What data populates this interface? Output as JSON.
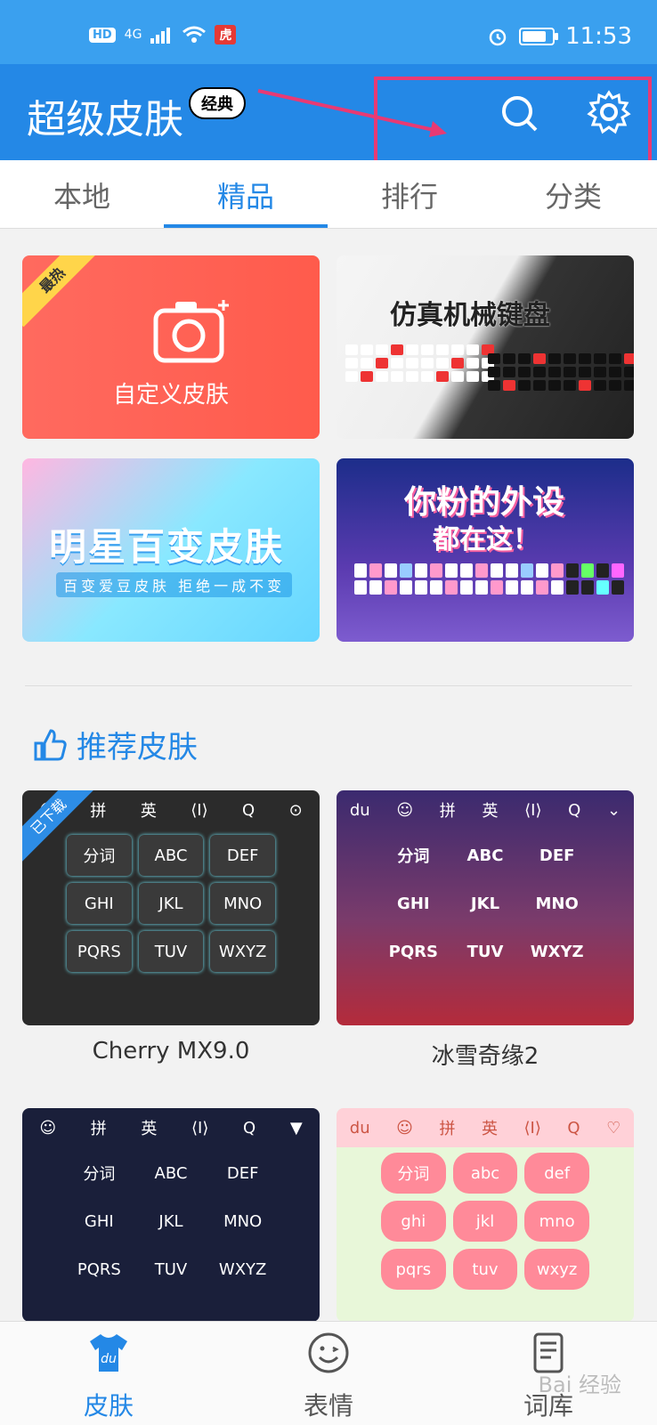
{
  "status_bar": {
    "hd": "HD",
    "network": "4G",
    "app_badge": "虎",
    "time": "11:53",
    "battery_level": 0.85
  },
  "app_bar": {
    "title": "超级皮肤",
    "badge": "经典"
  },
  "tabs": [
    "本地",
    "精品",
    "排行",
    "分类"
  ],
  "active_tab": 1,
  "banners": {
    "custom": {
      "label": "自定义皮肤",
      "ribbon": "最热"
    },
    "mechanical": {
      "title": "仿真机械键盘"
    },
    "star": {
      "title": "明星百变皮肤",
      "subtitle": "百变爱豆皮肤 拒绝一成不变"
    },
    "pink": {
      "line1": "你粉的外设",
      "line2": "都在这！"
    }
  },
  "section": {
    "title": "推荐皮肤"
  },
  "keyboards": [
    {
      "name": "Cherry MX9.0",
      "ribbon": "已下载",
      "bar": [
        "☺",
        "拼",
        "英",
        "⟨I⟩",
        "Q",
        "⊙"
      ],
      "keys": [
        "分词",
        "ABC",
        "DEF",
        "GHI",
        "JKL",
        "MNO",
        "PQRS",
        "TUV",
        "WXYZ"
      ]
    },
    {
      "name": "冰雪奇缘2",
      "bar": [
        "du",
        "☺",
        "拼",
        "英",
        "⟨I⟩",
        "Q",
        "⌄"
      ],
      "keys": [
        "分词",
        "ABC",
        "DEF",
        "GHI",
        "JKL",
        "MNO",
        "PQRS",
        "TUV",
        "WXYZ"
      ]
    },
    {
      "name": "",
      "bar": [
        "☺",
        "拼",
        "英",
        "⟨I⟩",
        "Q",
        "▼"
      ],
      "keys": [
        "分词",
        "ABC",
        "DEF",
        "GHI",
        "JKL",
        "MNO",
        "PQRS",
        "TUV",
        "WXYZ"
      ]
    },
    {
      "name": "",
      "bar": [
        "du",
        "☺",
        "拼",
        "英",
        "⟨I⟩",
        "Q",
        "♡"
      ],
      "keys": [
        "分词",
        "abc",
        "def",
        "ghi",
        "jkl",
        "mno",
        "pqrs",
        "tuv",
        "wxyz"
      ]
    }
  ],
  "bottom_nav": [
    "皮肤",
    "表情",
    "词库"
  ],
  "active_nav": 0,
  "watermark": "Bai 经验"
}
